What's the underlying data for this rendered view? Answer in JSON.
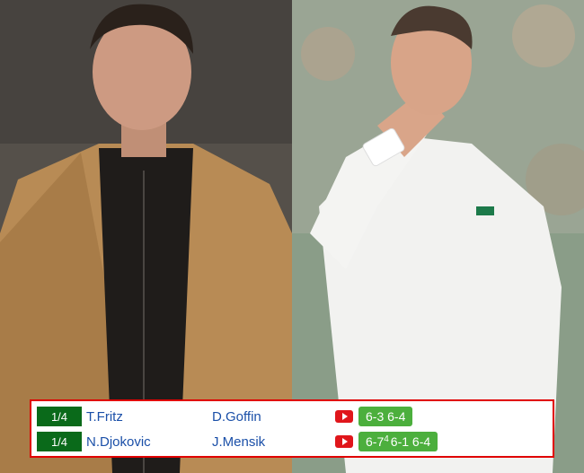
{
  "images": {
    "left_photo": "player-portrait-left",
    "right_photo": "player-celebration-right"
  },
  "colors": {
    "frame_border": "#e00000",
    "round_badge": "#0a6a1a",
    "score_badge": "#4caf3d",
    "player_link": "#1a4fa8",
    "video_icon": "#e0161b"
  },
  "results": {
    "rows": [
      {
        "round": "1/4",
        "player_a": "T.Fritz",
        "player_b": "D.Goffin",
        "video_icon": "youtube-play-icon",
        "score": "6-3 6-4"
      },
      {
        "round": "1/4",
        "player_a": "N.Djokovic",
        "player_b": "J.Mensik",
        "video_icon": "youtube-play-icon",
        "score_parts": {
          "set1": "6-7",
          "set1_tiebreak": "4",
          "rest": "6-1 6-4"
        }
      }
    ]
  }
}
